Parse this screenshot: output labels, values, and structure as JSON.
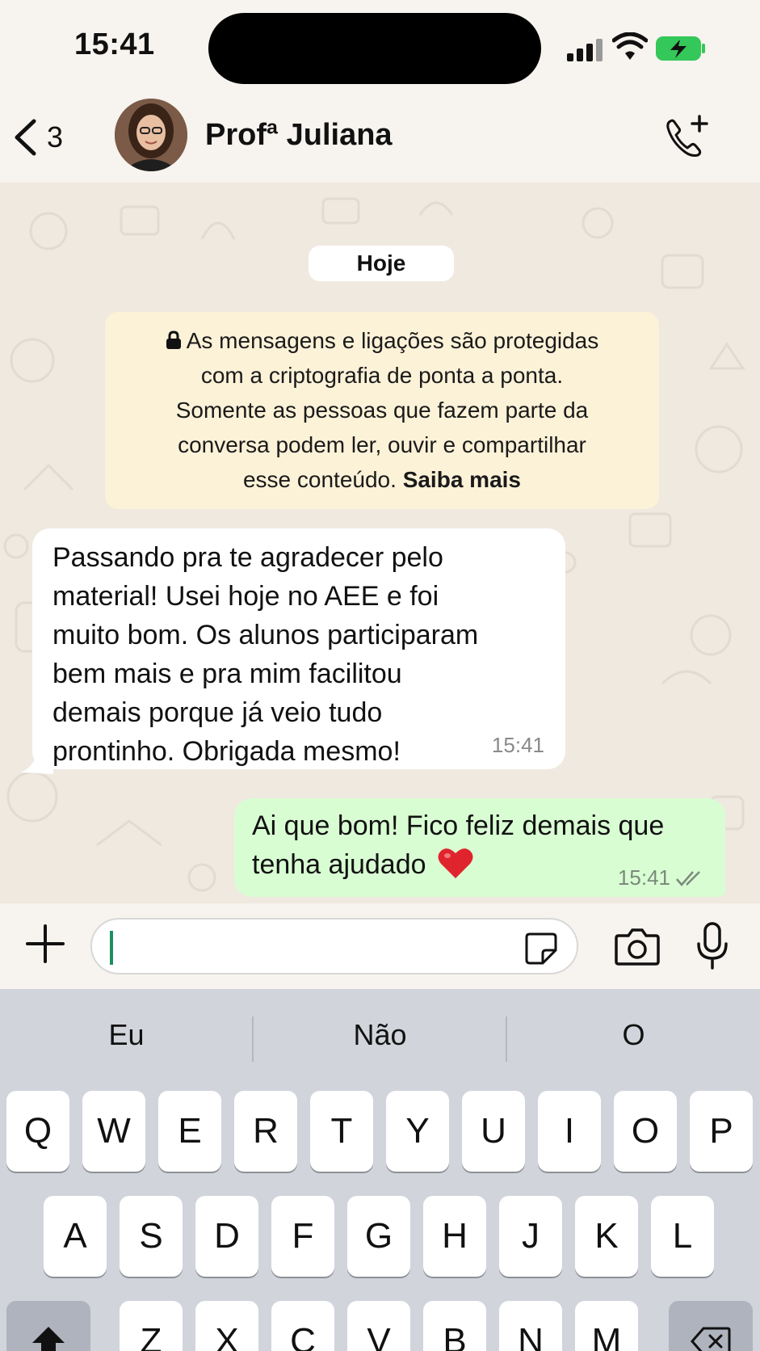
{
  "status_bar": {
    "time": "15:41"
  },
  "header": {
    "back_count": "3",
    "contact_name": "Profª Juliana"
  },
  "chat": {
    "date_label": "Hoje",
    "encryption_notice": {
      "lines": [
        "As mensagens e ligações são protegidas",
        "com a criptografia de ponta a ponta.",
        "Somente as pessoas que fazem parte da",
        "conversa podem ler, ouvir e compartilhar"
      ],
      "last_line_prefix": "esse conteúdo.",
      "link_text": "Saiba mais"
    },
    "incoming_message": {
      "lines": [
        "Passando pra te agradecer pelo",
        "material! Usei hoje no AEE e foi",
        "muito bom. Os alunos participaram",
        "bem mais e pra mim facilitou",
        "demais porque já veio tudo",
        "prontinho. Obrigada mesmo!"
      ],
      "time": "15:41"
    },
    "outgoing_message": {
      "lines": [
        "Ai que bom! Fico feliz demais que",
        "tenha ajudado"
      ],
      "time": "15:41",
      "status_icon": "double-check-icon"
    }
  },
  "composer": {
    "input_value": ""
  },
  "keyboard": {
    "suggestions": [
      "Eu",
      "Não",
      "O"
    ],
    "rows": [
      [
        "Q",
        "W",
        "E",
        "R",
        "T",
        "Y",
        "U",
        "I",
        "O",
        "P"
      ],
      [
        "A",
        "S",
        "D",
        "F",
        "G",
        "H",
        "J",
        "K",
        "L"
      ],
      [
        "Z",
        "X",
        "C",
        "V",
        "B",
        "N",
        "M"
      ]
    ]
  },
  "colors": {
    "chat_background": "#efe9e0",
    "incoming_bubble": "#ffffff",
    "outgoing_bubble": "#d9fdd3",
    "encryption_notice": "#fcf2d8",
    "battery_green": "#34c759",
    "caret": "#1a8f60"
  }
}
